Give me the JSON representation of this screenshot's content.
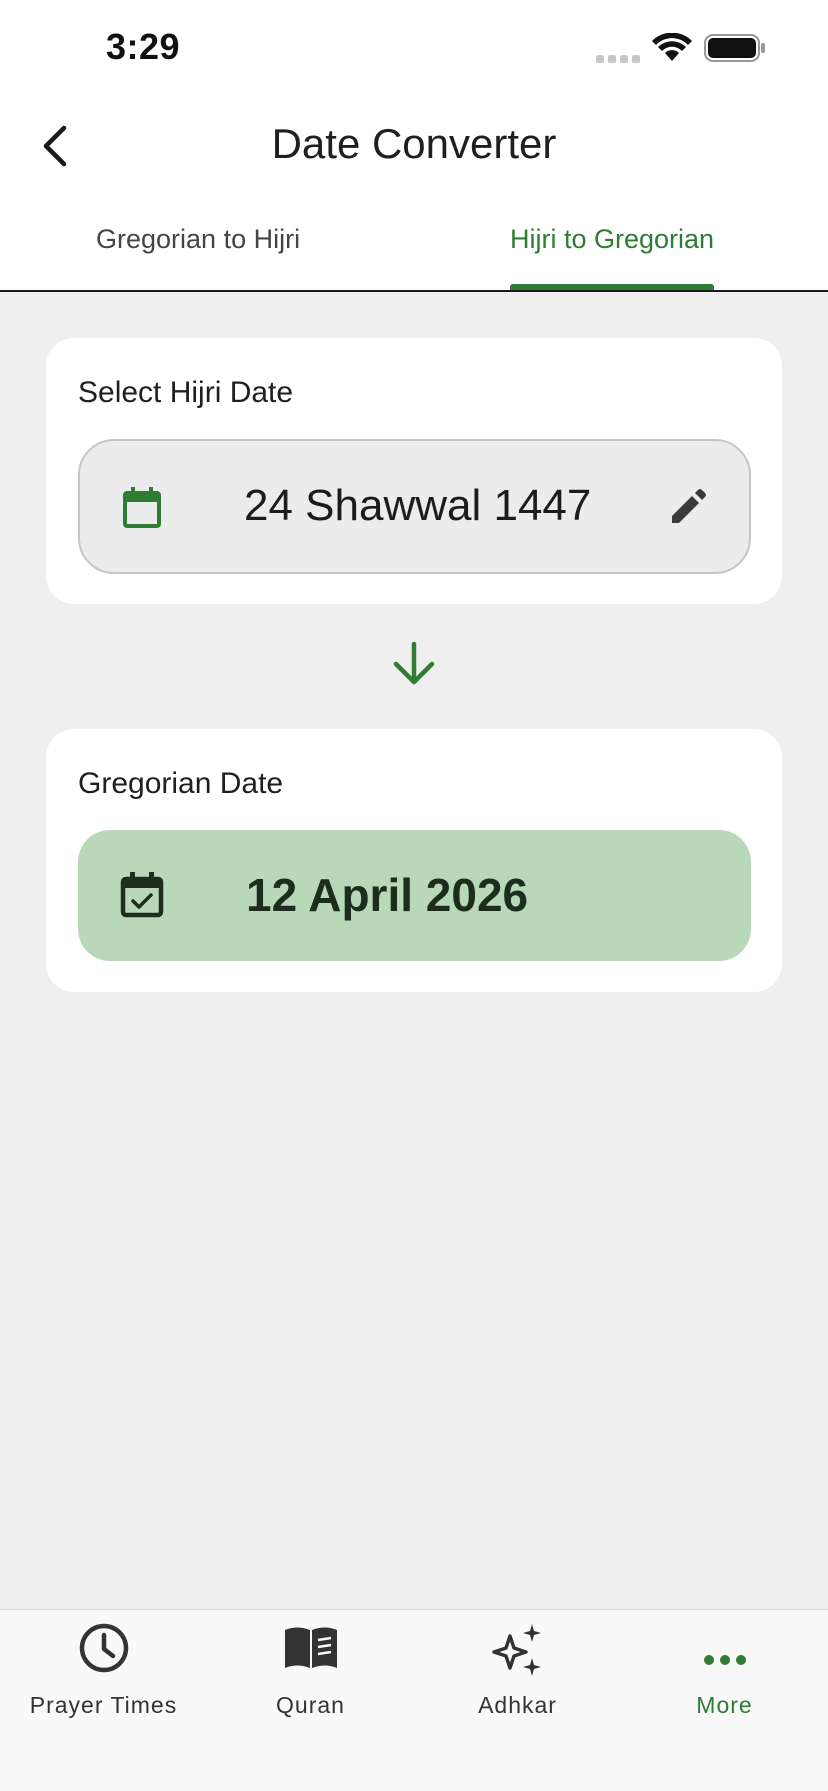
{
  "status_bar": {
    "time": "3:29"
  },
  "header": {
    "title": "Date Converter"
  },
  "tabs": [
    {
      "label": "Gregorian to Hijri",
      "active": false
    },
    {
      "label": "Hijri to Gregorian",
      "active": true
    }
  ],
  "hijri_card": {
    "label": "Select Hijri Date",
    "value": "24 Shawwal 1447",
    "icon": "calendar-icon",
    "action_icon": "edit-pencil-icon"
  },
  "gregorian_card": {
    "label": "Gregorian Date",
    "value": "12 April 2026",
    "icon": "calendar-check-icon"
  },
  "bottom_nav": [
    {
      "label": "Prayer Times",
      "icon": "clock-icon",
      "active": false
    },
    {
      "label": "Quran",
      "icon": "book-icon",
      "active": false
    },
    {
      "label": "Adhkar",
      "icon": "sparkles-icon",
      "active": false
    },
    {
      "label": "More",
      "icon": "more-dots-icon",
      "active": true
    }
  ],
  "colors": {
    "accent": "#2e7d32",
    "result_background": "#b9d8b9",
    "page_background": "#efefef"
  }
}
